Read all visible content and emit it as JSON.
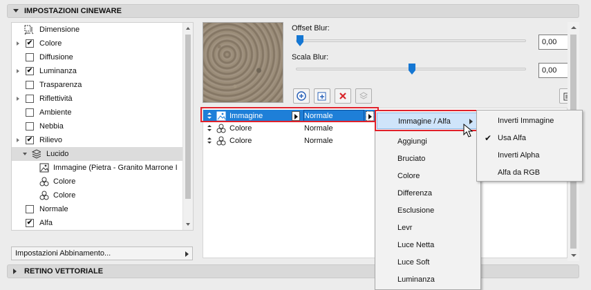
{
  "sections": {
    "cineware_title": "IMPOSTAZIONI CINEWARE",
    "retino_title": "RETINO VETTORIALE"
  },
  "tree": {
    "items": [
      {
        "label": "Dimensione",
        "checked": null
      },
      {
        "label": "Colore",
        "checked": true
      },
      {
        "label": "Diffusione",
        "checked": false
      },
      {
        "label": "Luminanza",
        "checked": true
      },
      {
        "label": "Trasparenza",
        "checked": false
      },
      {
        "label": "Riflettività",
        "checked": false
      },
      {
        "label": "Ambiente",
        "checked": false
      },
      {
        "label": "Nebbia",
        "checked": false
      },
      {
        "label": "Rilievo",
        "checked": true
      },
      {
        "label": "Lucido",
        "checked": null
      },
      {
        "label": "Immagine (Pietra - Granito Marrone I",
        "checked": null
      },
      {
        "label": "Colore",
        "checked": null
      },
      {
        "label": "Colore",
        "checked": null
      },
      {
        "label": "Normale",
        "checked": false
      },
      {
        "label": "Alfa",
        "checked": true
      }
    ],
    "check_mark": "✔"
  },
  "match_dropdown": "Impostazioni Abbinamento...",
  "offset_blur": {
    "label": "Offset Blur:",
    "value": "0,00",
    "level": 0.0
  },
  "scala_blur": {
    "label": "Scala Blur:",
    "value": "0,00",
    "level": 0.5
  },
  "layers": [
    {
      "name": "Immagine",
      "mode": "Normale",
      "selected": true
    },
    {
      "name": "Colore",
      "mode": "Normale",
      "selected": false
    },
    {
      "name": "Colore",
      "mode": "Normale",
      "selected": false
    }
  ],
  "blend_menu": {
    "header": "Immagine / Alfa",
    "items": [
      "Aggiungi",
      "Bruciato",
      "Colore",
      "Differenza",
      "Esclusione",
      "Levr",
      "Luce Netta",
      "Luce Soft",
      "Luminanza"
    ]
  },
  "alpha_submenu": {
    "items": [
      {
        "label": "Inverti Immagine",
        "checked": false
      },
      {
        "label": "Usa Alfa",
        "checked": true
      },
      {
        "label": "Inverti Alpha",
        "checked": false
      },
      {
        "label": "Alfa da RGB",
        "checked": false
      }
    ]
  },
  "colors": {
    "accent": "#1e7fd8",
    "highlight": "#e0202a"
  }
}
